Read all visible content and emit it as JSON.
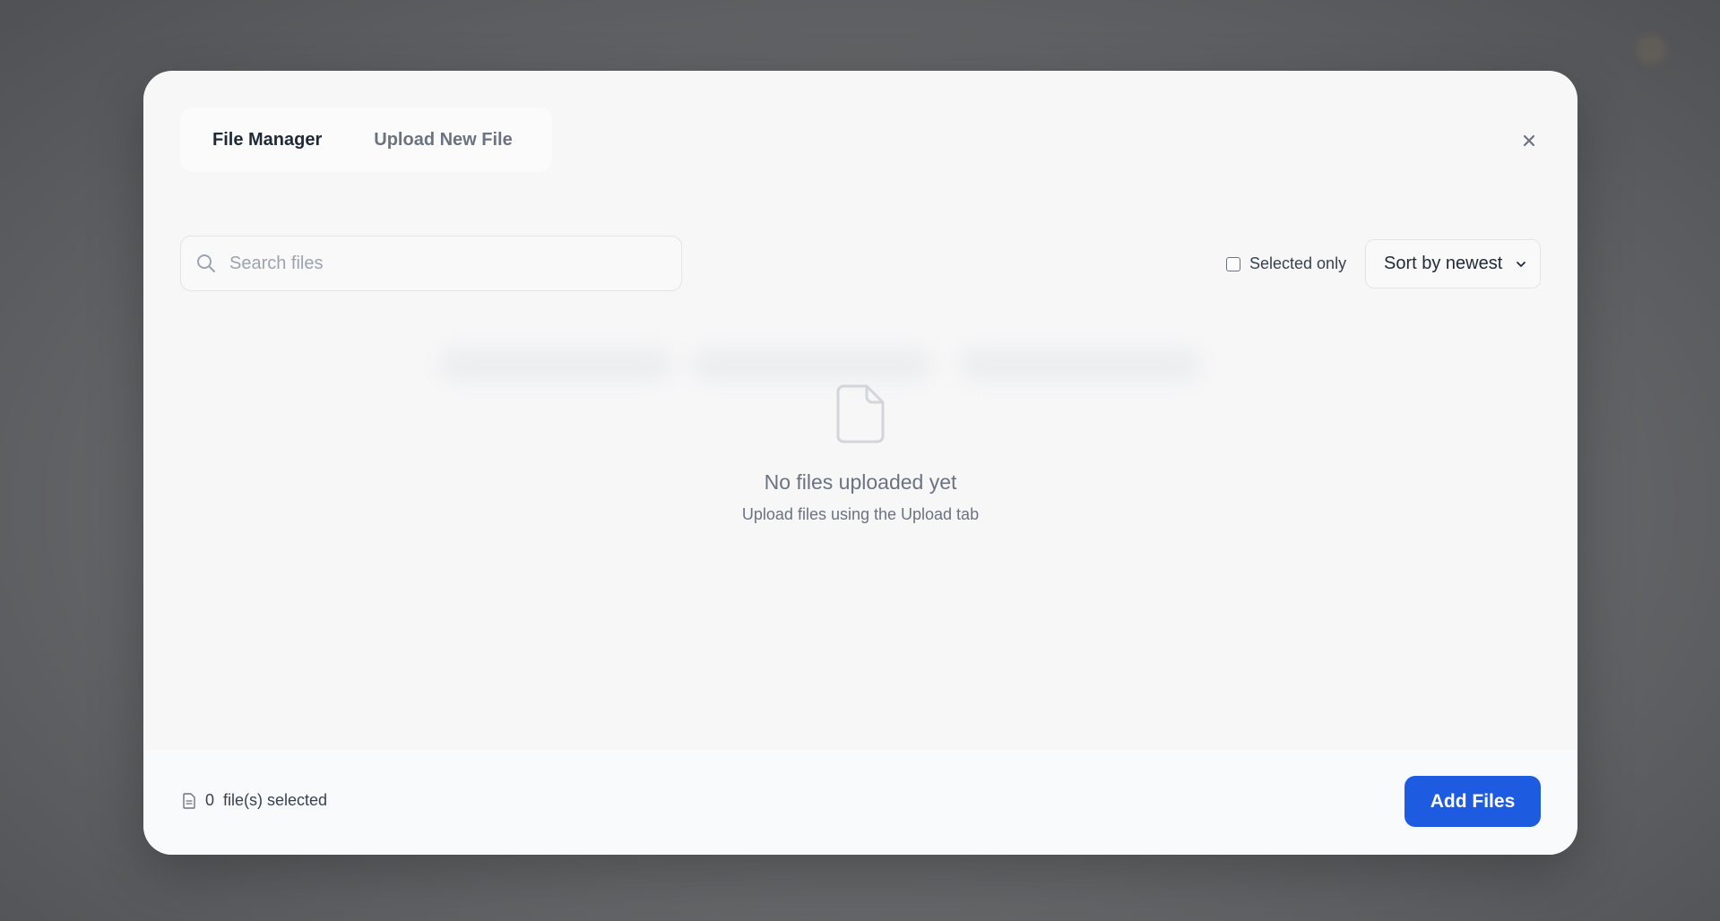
{
  "tabs": {
    "file_manager": "File Manager",
    "upload_new_file": "Upload New File",
    "active": "file_manager"
  },
  "toolbar": {
    "search_placeholder": "Search files",
    "search_value": "",
    "selected_only_label": "Selected only",
    "selected_only_checked": false,
    "sort_label": "Sort by newest"
  },
  "empty_state": {
    "title": "No files uploaded yet",
    "subtitle": "Upload files using the Upload tab"
  },
  "footer": {
    "selected_count": "0",
    "selected_suffix": "file(s) selected",
    "add_button_label": "Add Files"
  },
  "icons": {
    "close": "close-icon",
    "search": "search-icon",
    "empty_file": "file-icon",
    "footer_file": "document-icon",
    "sort_chevron": "chevron-down-icon"
  },
  "colors": {
    "accent": "#1d5be0",
    "text_primary": "#1f2937",
    "text_muted": "#6b7280"
  }
}
